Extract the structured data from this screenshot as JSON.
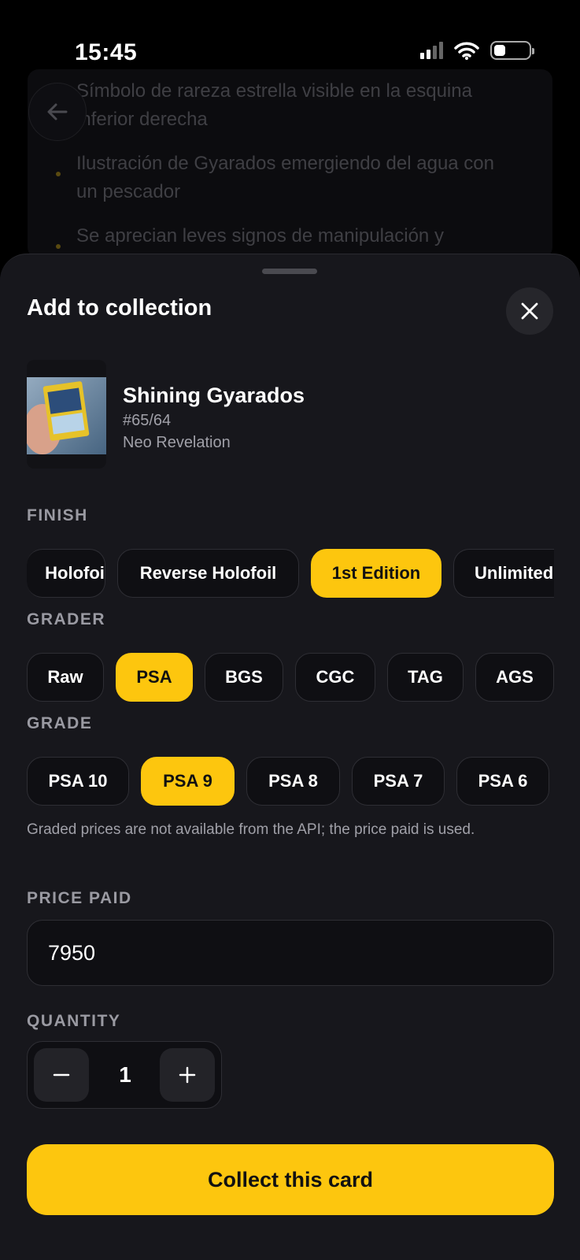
{
  "status_bar": {
    "time": "15:45"
  },
  "background": {
    "bullets": [
      "Símbolo de rareza estrella visible en la esquina inferior derecha",
      "Ilustración de Gyarados emergiendo del agua con un pescador",
      "Se aprecian leves signos de manipulación y"
    ]
  },
  "sheet": {
    "title": "Add to collection",
    "card": {
      "name": "Shining Gyarados",
      "number": "#65/64",
      "set": "Neo Revelation"
    },
    "finish": {
      "label": "FINISH",
      "options": [
        "Holofoil",
        "Reverse Holofoil",
        "1st Edition",
        "Unlimited"
      ],
      "selected": "1st Edition"
    },
    "grader": {
      "label": "GRADER",
      "options": [
        "Raw",
        "PSA",
        "BGS",
        "CGC",
        "TAG",
        "AGS"
      ],
      "selected": "PSA"
    },
    "grade": {
      "label": "GRADE",
      "options": [
        "PSA 10",
        "PSA 9",
        "PSA 8",
        "PSA 7",
        "PSA 6"
      ],
      "selected": "PSA 9"
    },
    "hint": "Graded prices are not available from the API; the price paid is used.",
    "price": {
      "label": "PRICE PAID",
      "value": "7950"
    },
    "quantity": {
      "label": "QUANTITY",
      "value": "1"
    },
    "cta": "Collect this card"
  },
  "colors": {
    "accent": "#fdc60e",
    "sheet_bg": "#17171c",
    "chip_bg": "#0f0f13"
  }
}
